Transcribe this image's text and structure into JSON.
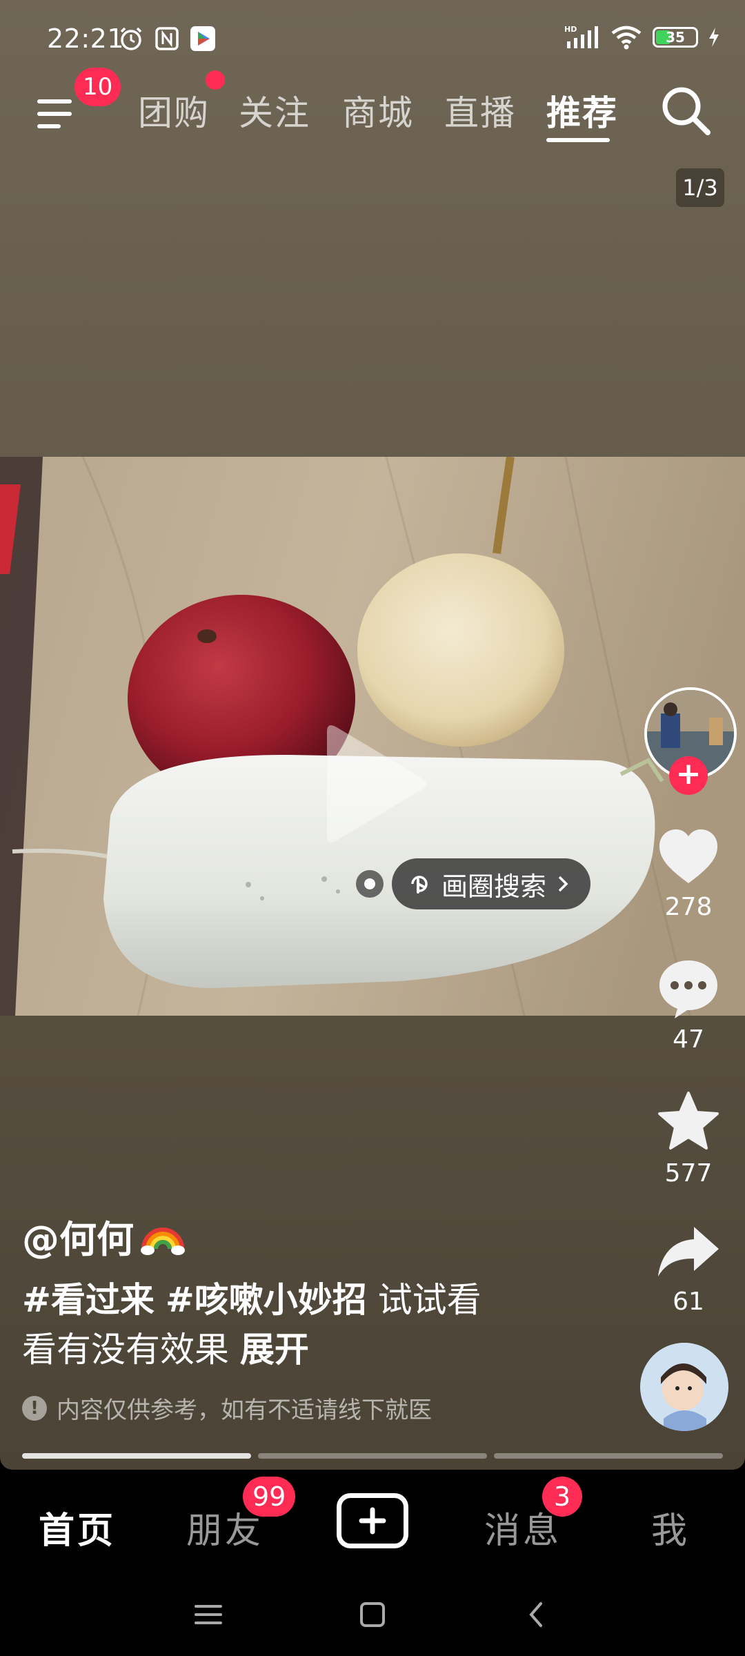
{
  "status_bar": {
    "time": "22:21",
    "battery": "35",
    "icons_left": [
      "alarm-icon",
      "nfc-icon",
      "play-store-icon"
    ],
    "icons_right": [
      "hd-signal-icon",
      "wifi-icon",
      "battery-icon",
      "charging-icon"
    ]
  },
  "top_nav": {
    "menu_badge": "10",
    "tabs": [
      {
        "label": "团购"
      },
      {
        "label": "关注"
      },
      {
        "label": "商城"
      },
      {
        "label": "直播"
      },
      {
        "label": "推荐"
      }
    ],
    "active_tab": "推荐"
  },
  "post": {
    "page_indicator": "1/3",
    "circle_search_label": "画圈搜索",
    "author": "@何何",
    "hashtags": [
      "#看过来",
      "#咳嗽小妙招"
    ],
    "caption_text_1": "试试看",
    "caption_text_2": "看有没有效果",
    "expand_label": "展开",
    "disclaimer": "内容仅供参考，如有不适请线下就医",
    "image_pages": 3,
    "current_page": 1
  },
  "actions": {
    "likes": "278",
    "comments": "47",
    "favorites": "577",
    "shares": "61"
  },
  "bottom_nav": {
    "home": "首页",
    "friends": "朋友",
    "friends_badge": "99",
    "messages": "消息",
    "messages_badge": "3",
    "me": "我"
  },
  "colors": {
    "accent": "#fe2c55",
    "background": "#655c4c"
  }
}
